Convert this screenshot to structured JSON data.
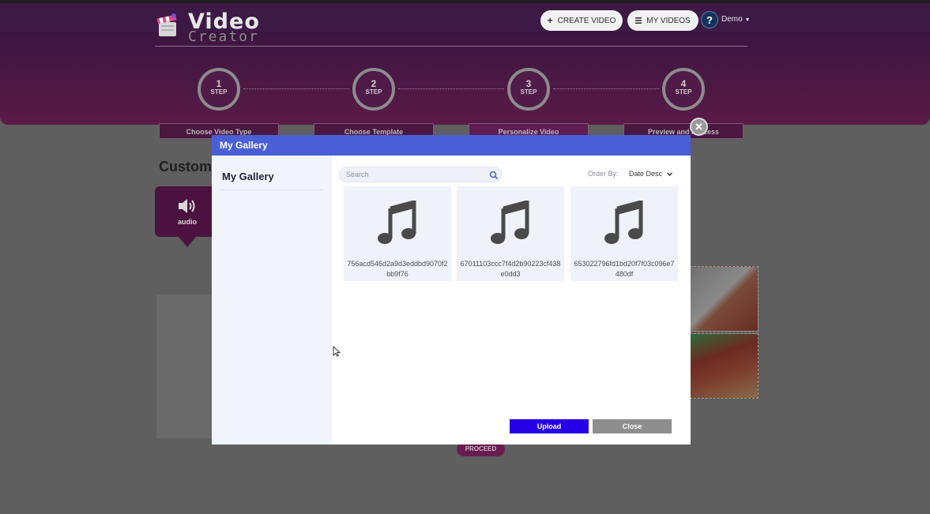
{
  "header": {
    "logo": {
      "line1": "Video",
      "line2": "Creator"
    },
    "nav": {
      "create_video_label": "CREATE VIDEO",
      "my_videos_label": "MY VIDEOS",
      "help_label": "?",
      "user_label": "Demo"
    }
  },
  "steps": [
    {
      "number": "1",
      "word": "STEP",
      "label": "Choose Video Type"
    },
    {
      "number": "2",
      "word": "STEP",
      "label": "Choose Template"
    },
    {
      "number": "3",
      "word": "STEP",
      "label": "Personalize Video"
    },
    {
      "number": "4",
      "word": "STEP",
      "label": "Preview and Process"
    }
  ],
  "page": {
    "section_title": "Custom",
    "audio_card_label": "audio",
    "proceed_label": "PROCEED"
  },
  "modal": {
    "title": "My Gallery",
    "sidebar_title": "My Gallery",
    "search_placeholder": "Search",
    "order_by_label": "Order By:",
    "order_by_value": "Date Desc",
    "files": [
      {
        "name": "756acd546d2a9d3eddbd9070f2bb9f76",
        "icon": "music-note-icon"
      },
      {
        "name": "67011103ccc7f4d2b90223cf438e0dd3",
        "icon": "music-note-icon"
      },
      {
        "name": "653022796fd1bd20f7f03c096e7480df",
        "icon": "music-note-icon"
      }
    ],
    "upload_label": "Upload",
    "close_label": "Close"
  },
  "colors": {
    "modal_header": "#4a5fd6",
    "upload_button": "#2500e6",
    "close_button": "#8e8e8e",
    "hero": "#4a1843",
    "overlay": "#5f5f5f"
  }
}
